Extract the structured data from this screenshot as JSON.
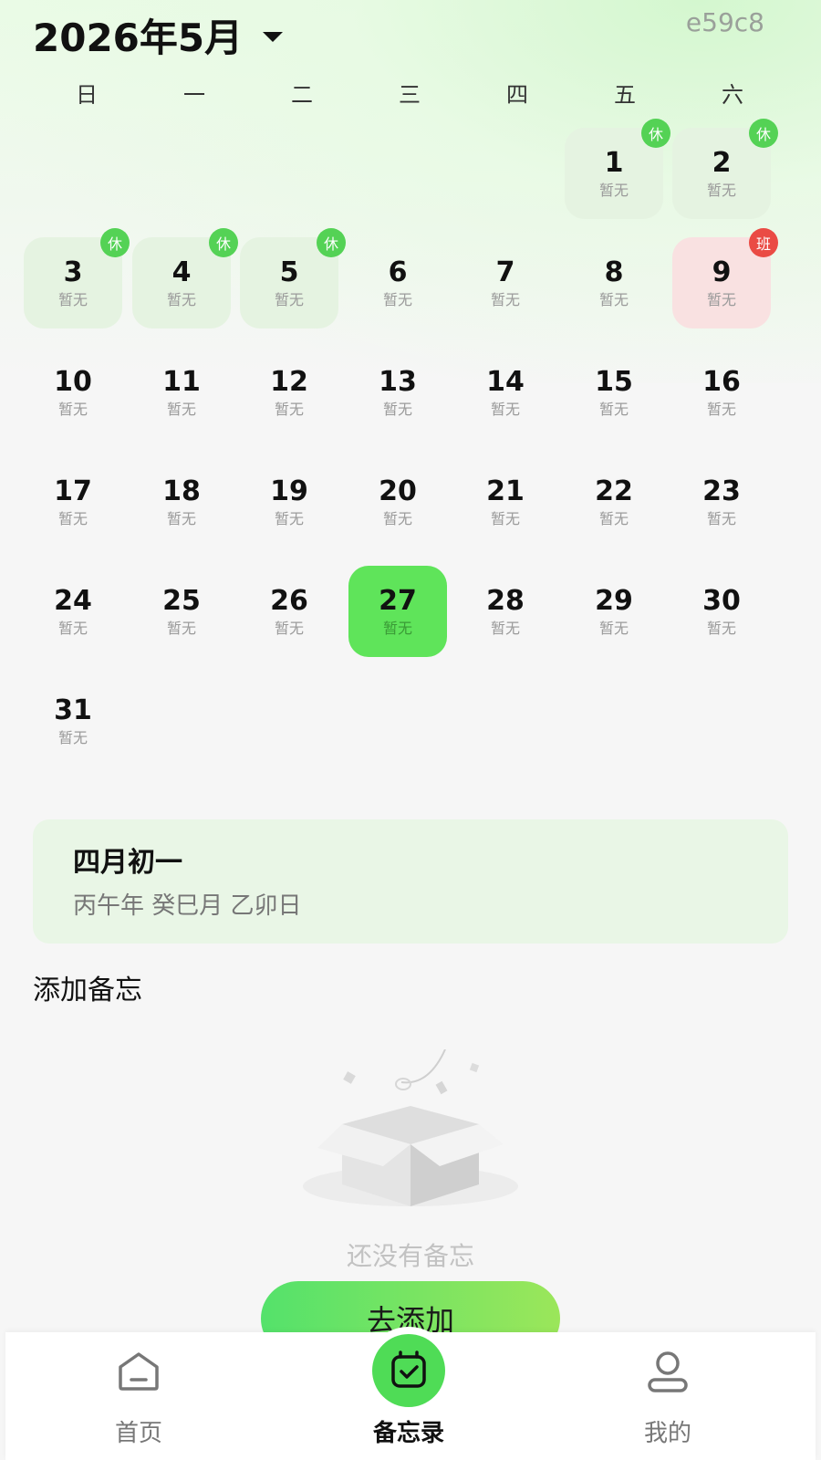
{
  "header": {
    "title": "2026年5月",
    "code": "e59c8"
  },
  "weekdays": [
    "日",
    "一",
    "二",
    "三",
    "四",
    "五",
    "六"
  ],
  "calendar": {
    "empty_label": "暂无",
    "badges": {
      "rest": "休",
      "work": "班"
    },
    "days": [
      {
        "day": 1,
        "sub": "暂无",
        "type": "rest",
        "badge": "休"
      },
      {
        "day": 2,
        "sub": "暂无",
        "type": "rest",
        "badge": "休"
      },
      {
        "day": 3,
        "sub": "暂无",
        "type": "rest",
        "badge": "休"
      },
      {
        "day": 4,
        "sub": "暂无",
        "type": "rest",
        "badge": "休"
      },
      {
        "day": 5,
        "sub": "暂无",
        "type": "rest",
        "badge": "休"
      },
      {
        "day": 6,
        "sub": "暂无",
        "type": "",
        "badge": ""
      },
      {
        "day": 7,
        "sub": "暂无",
        "type": "",
        "badge": ""
      },
      {
        "day": 8,
        "sub": "暂无",
        "type": "",
        "badge": ""
      },
      {
        "day": 9,
        "sub": "暂无",
        "type": "work",
        "badge": "班"
      },
      {
        "day": 10,
        "sub": "暂无",
        "type": "",
        "badge": ""
      },
      {
        "day": 11,
        "sub": "暂无",
        "type": "",
        "badge": ""
      },
      {
        "day": 12,
        "sub": "暂无",
        "type": "",
        "badge": ""
      },
      {
        "day": 13,
        "sub": "暂无",
        "type": "",
        "badge": ""
      },
      {
        "day": 14,
        "sub": "暂无",
        "type": "",
        "badge": ""
      },
      {
        "day": 15,
        "sub": "暂无",
        "type": "",
        "badge": ""
      },
      {
        "day": 16,
        "sub": "暂无",
        "type": "",
        "badge": ""
      },
      {
        "day": 17,
        "sub": "暂无",
        "type": "",
        "badge": ""
      },
      {
        "day": 18,
        "sub": "暂无",
        "type": "",
        "badge": ""
      },
      {
        "day": 19,
        "sub": "暂无",
        "type": "",
        "badge": ""
      },
      {
        "day": 20,
        "sub": "暂无",
        "type": "",
        "badge": ""
      },
      {
        "day": 21,
        "sub": "暂无",
        "type": "",
        "badge": ""
      },
      {
        "day": 22,
        "sub": "暂无",
        "type": "",
        "badge": ""
      },
      {
        "day": 23,
        "sub": "暂无",
        "type": "",
        "badge": ""
      },
      {
        "day": 24,
        "sub": "暂无",
        "type": "",
        "badge": ""
      },
      {
        "day": 25,
        "sub": "暂无",
        "type": "",
        "badge": ""
      },
      {
        "day": 26,
        "sub": "暂无",
        "type": "",
        "badge": ""
      },
      {
        "day": 27,
        "sub": "暂无",
        "type": "today",
        "badge": ""
      },
      {
        "day": 28,
        "sub": "暂无",
        "type": "",
        "badge": ""
      },
      {
        "day": 29,
        "sub": "暂无",
        "type": "",
        "badge": ""
      },
      {
        "day": 30,
        "sub": "暂无",
        "type": "",
        "badge": ""
      },
      {
        "day": 31,
        "sub": "暂无",
        "type": "",
        "badge": ""
      }
    ]
  },
  "lunar": {
    "date": "四月初一",
    "ganzhi": "丙午年 癸巳月 乙卯日"
  },
  "memo": {
    "title": "添加备忘",
    "empty_text": "还没有备忘",
    "add_button": "去添加"
  },
  "tabbar": {
    "items": [
      {
        "label": "首页",
        "icon": "home-icon"
      },
      {
        "label": "备忘录",
        "icon": "memo-icon"
      },
      {
        "label": "我的",
        "icon": "profile-icon"
      }
    ]
  },
  "colors": {
    "accent": "#5fe45a",
    "rest_bg": "#e5f3e1",
    "work_bg": "#f9e1e1",
    "rest_badge": "#54d255",
    "work_badge": "#ea4b44"
  }
}
